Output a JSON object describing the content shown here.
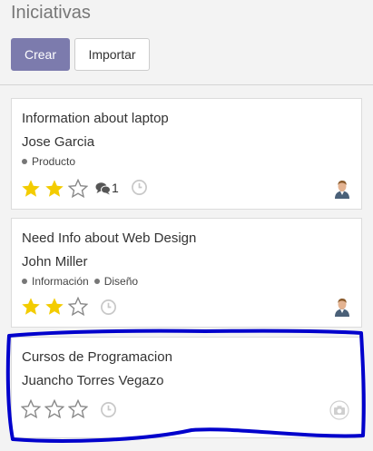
{
  "page": {
    "title": "Iniciativas"
  },
  "toolbar": {
    "create_label": "Crear",
    "import_label": "Importar"
  },
  "cards": [
    {
      "name": "Information about laptop",
      "partner": "Jose Garcia",
      "tags": [
        "Producto"
      ],
      "priority": 2,
      "priority_max": 3,
      "message_count": "1",
      "has_avatar": true
    },
    {
      "name": "Need Info about Web Design",
      "partner": "John Miller",
      "tags": [
        "Información",
        "Diseño"
      ],
      "priority": 2,
      "priority_max": 3,
      "has_avatar": true
    },
    {
      "name": "Cursos de Programacion",
      "partner": "Juancho Torres Vegazo",
      "tags": [],
      "priority": 0,
      "priority_max": 3,
      "has_avatar": false
    }
  ],
  "colors": {
    "primary": "#7c7bad",
    "star_filled": "#f3cc00",
    "highlight": "#0000cc"
  }
}
